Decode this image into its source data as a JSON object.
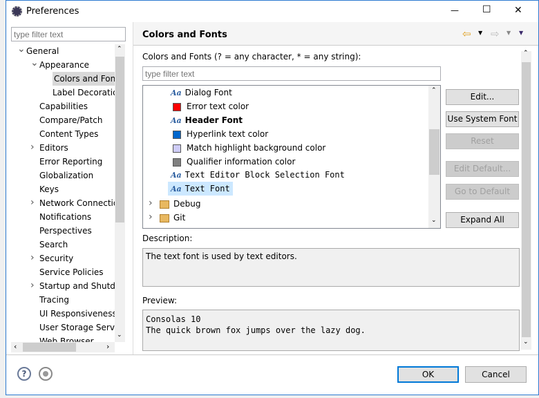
{
  "window": {
    "title": "Preferences",
    "minimize": "—",
    "maximize": "☐",
    "close": "✕"
  },
  "left": {
    "filter_placeholder": "type filter text",
    "items": [
      {
        "label": "General",
        "level": 0,
        "chev": "v"
      },
      {
        "label": "Appearance",
        "level": 1,
        "chev": "v"
      },
      {
        "label": "Colors and Fonts",
        "level": 2,
        "chev": "",
        "selected": true
      },
      {
        "label": "Label Decorations",
        "level": 2,
        "chev": ""
      },
      {
        "label": "Capabilities",
        "level": 1,
        "chev": ""
      },
      {
        "label": "Compare/Patch",
        "level": 1,
        "chev": ""
      },
      {
        "label": "Content Types",
        "level": 1,
        "chev": ""
      },
      {
        "label": "Editors",
        "level": 1,
        "chev": ">"
      },
      {
        "label": "Error Reporting",
        "level": 1,
        "chev": ""
      },
      {
        "label": "Globalization",
        "level": 1,
        "chev": ""
      },
      {
        "label": "Keys",
        "level": 1,
        "chev": ""
      },
      {
        "label": "Network Connections",
        "level": 1,
        "chev": ">"
      },
      {
        "label": "Notifications",
        "level": 1,
        "chev": ""
      },
      {
        "label": "Perspectives",
        "level": 1,
        "chev": ""
      },
      {
        "label": "Search",
        "level": 1,
        "chev": ""
      },
      {
        "label": "Security",
        "level": 1,
        "chev": ">"
      },
      {
        "label": "Service Policies",
        "level": 1,
        "chev": ""
      },
      {
        "label": "Startup and Shutdown",
        "level": 1,
        "chev": ">"
      },
      {
        "label": "Tracing",
        "level": 1,
        "chev": ""
      },
      {
        "label": "UI Responsiveness",
        "level": 1,
        "chev": ""
      },
      {
        "label": "User Storage Service",
        "level": 1,
        "chev": ""
      },
      {
        "label": "Web Browser",
        "level": 1,
        "chev": ""
      }
    ]
  },
  "page": {
    "title": "Colors and Fonts",
    "back_icon": "arrow-left",
    "forward_icon": "arrow-right",
    "label": "Colors and Fonts (? = any character, * = any string):",
    "filter_placeholder": "type filter text",
    "items": [
      {
        "label": "Dialog Font",
        "kind": "font",
        "style": "normal"
      },
      {
        "label": "Error text color",
        "kind": "color",
        "color": "#ff0000"
      },
      {
        "label": "Header Font",
        "kind": "font",
        "style": "bold"
      },
      {
        "label": "Hyperlink text color",
        "kind": "color",
        "color": "#0066cc"
      },
      {
        "label": "Match highlight background color",
        "kind": "color",
        "color": "#ceccf7"
      },
      {
        "label": "Qualifier information color",
        "kind": "color",
        "color": "#808080"
      },
      {
        "label": "Text Editor Block Selection Font",
        "kind": "font",
        "style": "mono"
      },
      {
        "label": "Text Font",
        "kind": "font",
        "style": "mono",
        "selected": true
      },
      {
        "label": "Debug",
        "kind": "folder"
      },
      {
        "label": "Git",
        "kind": "folder"
      }
    ],
    "buttons": {
      "edit": "Edit...",
      "use_system_font": "Use System Font",
      "reset": "Reset",
      "edit_default": "Edit Default...",
      "go_to_default": "Go to Default",
      "expand_all": "Expand All"
    },
    "description_label": "Description:",
    "description": "The text font is used by text editors.",
    "preview_label": "Preview:",
    "preview_lines": [
      "Consolas 10",
      "The quick brown fox jumps over the lazy dog."
    ]
  },
  "footer": {
    "ok": "OK",
    "cancel": "Cancel"
  }
}
